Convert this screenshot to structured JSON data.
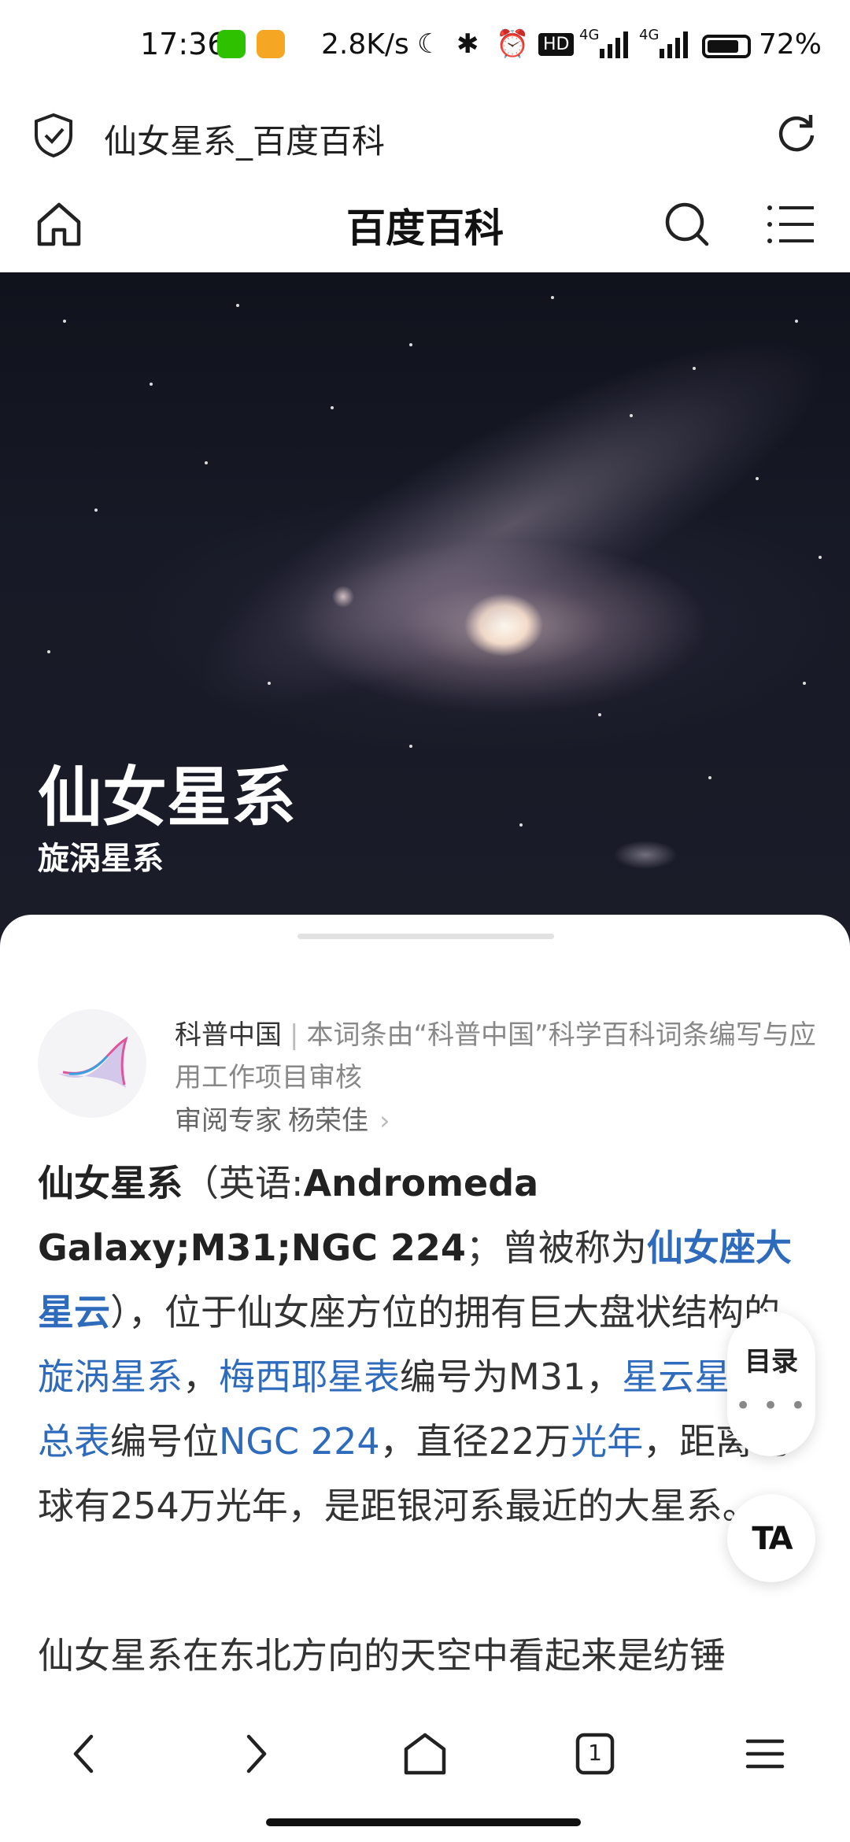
{
  "status_bar": {
    "time": "17:36",
    "net_speed": "2.8K/s",
    "battery_text": "72%",
    "battery_level": 0.72,
    "hd_badge": "HD",
    "network_1": "4G",
    "network_2": "4G"
  },
  "browser": {
    "page_title": "仙女星系_百度百科"
  },
  "site_header": {
    "brand": "百度百科"
  },
  "hero": {
    "title": "仙女星系",
    "subtitle": "旋涡星系"
  },
  "source_card": {
    "org": "科普中国",
    "separator": "|",
    "description": "本词条由“科普中国”科学百科词条编写与应用工作项目审核",
    "expert_label": "审阅专家",
    "expert_name": "杨荣佳",
    "expert_chevron": "›"
  },
  "article": {
    "p1": {
      "term": "仙女星系",
      "t1": "（英语:",
      "en": "Andromeda Galaxy;M31;NGC 224",
      "t2": "；曾被称为",
      "link1": "仙女座大星云",
      "t3": "），位于仙女座方位的拥有巨大盘状结构的",
      "link2": "旋涡星系",
      "t4": "，",
      "link3": "梅西耶星表",
      "t5": "编号为M31，",
      "link4": "星云星团新总表",
      "t6": "编号位",
      "link5": "NGC 224",
      "t7": "，直径22万",
      "link6": "光年",
      "t8": "，距离地球有254万光年，是距银河系最近的大星系。"
    },
    "p2": "仙女星系在东北方向的天空中看起来是纺锤"
  },
  "floating": {
    "toc_label": "目录",
    "toc_more": "• • •",
    "font_label": "TA"
  },
  "bottom_nav": {
    "tab_count": "1"
  }
}
